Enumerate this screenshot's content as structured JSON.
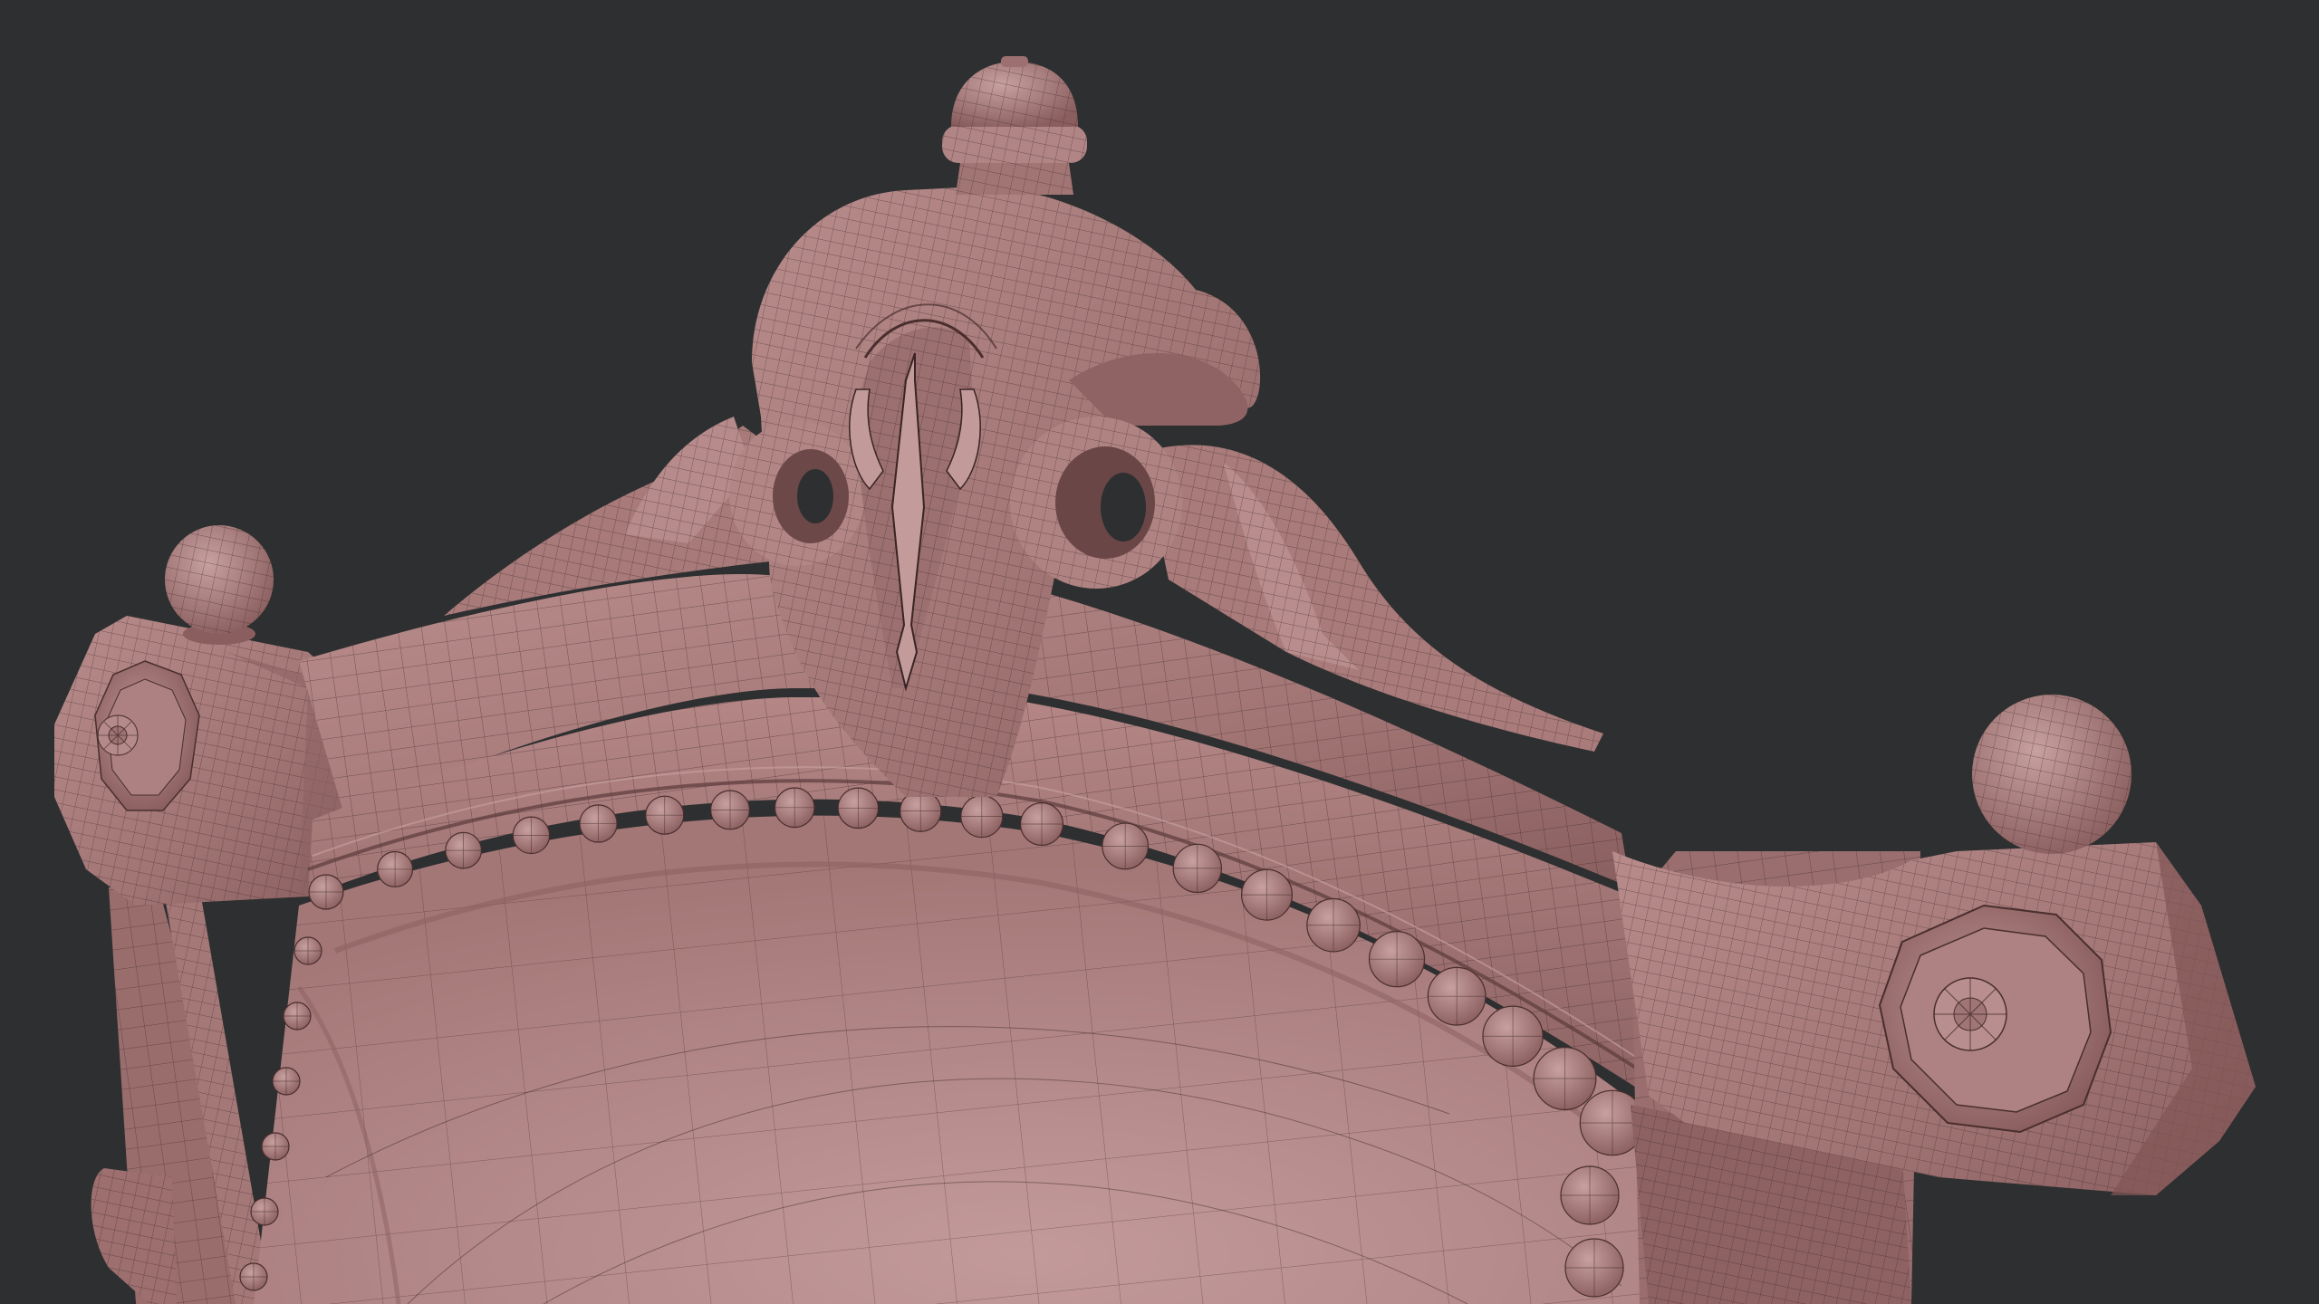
{
  "viewport": {
    "background": "#2e2f30",
    "mesh_color": "#a87878",
    "mesh_shadow": "#7d5454",
    "mesh_highlight": "#c59a9a",
    "wire_color": "#3a2424"
  },
  "model": {
    "subject": "carved-chair-backrest",
    "display_mode": "solid-with-wireframe"
  }
}
